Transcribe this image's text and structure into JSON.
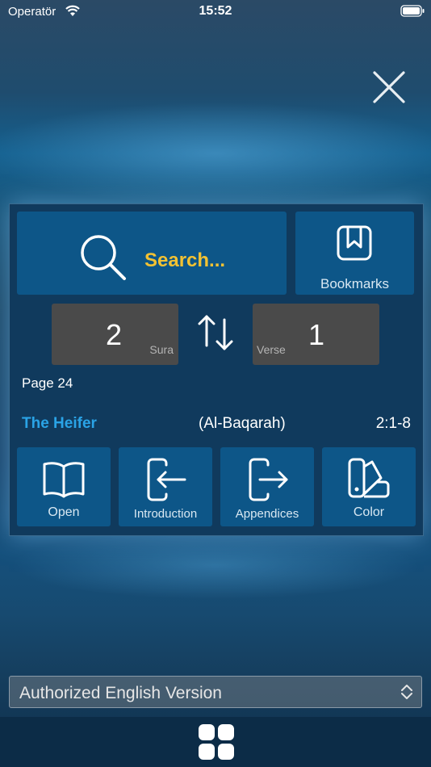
{
  "status_bar": {
    "carrier": "Operatör",
    "time": "15:52"
  },
  "search": {
    "label": "Search..."
  },
  "bookmarks": {
    "label": "Bookmarks"
  },
  "navigator": {
    "sura_value": "2",
    "sura_caption": "Sura",
    "verse_value": "1",
    "verse_caption": "Verse"
  },
  "page": {
    "label": "Page 24"
  },
  "sura_info": {
    "name": "The Heifer",
    "transliteration": "(Al-Baqarah)",
    "range": "2:1-8"
  },
  "actions": {
    "open": "Open",
    "introduction": "Introduction",
    "appendices": "Appendices",
    "color": "Color"
  },
  "version": {
    "selected": "Authorized English Version"
  },
  "colors": {
    "search_accent": "#f2c233",
    "sura_name": "#2aa3e6",
    "tile": "#0d5688",
    "panel": "#103a5d"
  },
  "icons": [
    "wifi-icon",
    "battery-icon",
    "close-icon",
    "search-icon",
    "bookmark-icon",
    "swap-icon",
    "book-open-icon",
    "enter-icon",
    "exit-icon",
    "swatch-icon",
    "select-arrows-icon",
    "grid-icon"
  ]
}
